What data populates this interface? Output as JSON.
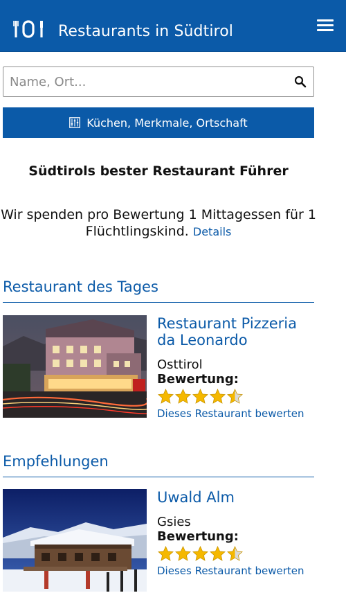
{
  "header": {
    "title": "Restaurants in Südtirol",
    "logo_icon": "cutlery-logo-icon",
    "menu_icon": "hamburger-menu-icon"
  },
  "search": {
    "placeholder": "Name, Ort...",
    "value": "",
    "icon": "search-icon"
  },
  "filter": {
    "label": "Küchen, Merkmale, Ortschaft",
    "icon": "filter-icon"
  },
  "intro": {
    "tagline": "Südtirols bester Restaurant Führer",
    "donation_text": "Wir spenden pro Bewertung 1 Mittagessen für 1 Flüchtlingskind.",
    "details_link": "Details"
  },
  "sections": {
    "daily_title": "Restaurant des Tages",
    "recommendations_title": "Empfehlungen"
  },
  "cards": [
    {
      "name": "Restaurant Pizzeria da Leonardo",
      "place": "Osttirol",
      "rating_label": "Bewertung:",
      "rating": 4.5,
      "rate_link": "Dieses Restaurant bewerten"
    },
    {
      "name": "Uwald Alm",
      "place": "Gsies",
      "rating_label": "Bewertung:",
      "rating": 4.5,
      "rate_link": "Dieses Restaurant bewerten"
    }
  ],
  "colors": {
    "brand_blue": "#0b5aa8",
    "star_gold": "#f5b800"
  }
}
